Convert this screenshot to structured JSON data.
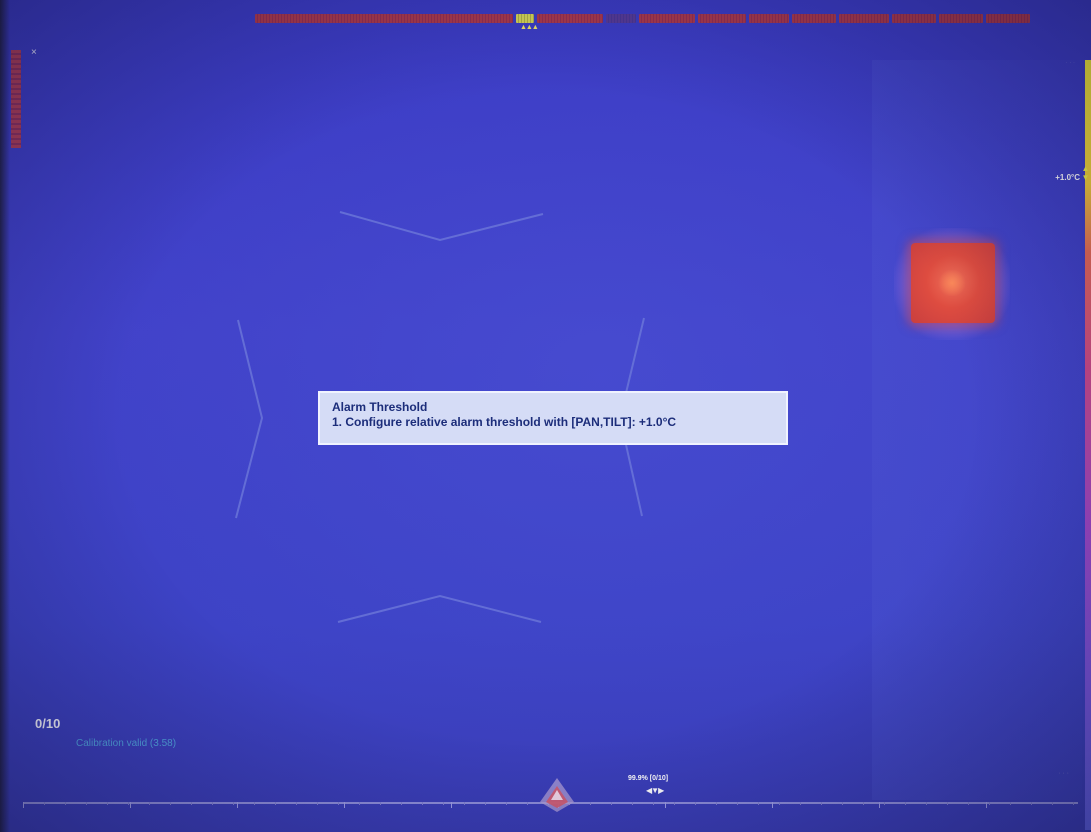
{
  "app": {
    "close_glyph": "×"
  },
  "message": {
    "title": "Alarm Threshold",
    "line": "1. Configure relative alarm threshold with [PAN,TILT]: +1.0°C"
  },
  "threshold": {
    "value_label": "+1.0°C",
    "arrows": "▲\n▼"
  },
  "scale": {
    "top_label": "",
    "low_label": ""
  },
  "status": {
    "counter": "0/10",
    "calibration": "Calibration valid (3.58)"
  },
  "pan": {
    "readout": "99.9% [0/10]",
    "arrows": "◀▼▶"
  },
  "colors": {
    "background": "#4142c9",
    "hot_spot": "#de4c40",
    "message_bg": "#d5dcf6",
    "message_text": "#1c2d7a",
    "calibration_text": "#52a4e0"
  },
  "icons": {
    "close": "close-icon",
    "threshold_adjust": "up-down-arrows-icon",
    "pan_tilt": "pan-tilt-arrows-icon",
    "pan_position": "diamond-marker-icon"
  }
}
